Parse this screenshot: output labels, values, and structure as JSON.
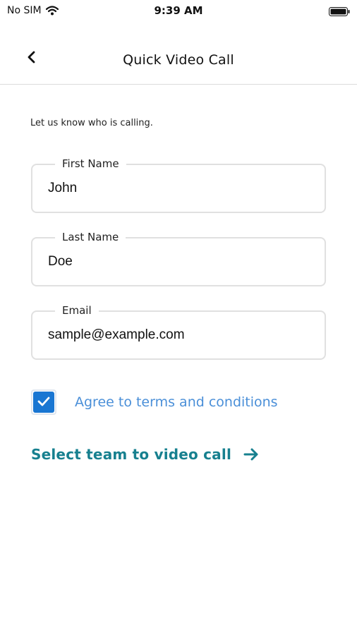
{
  "status_bar": {
    "carrier": "No SIM",
    "time": "9:39 AM",
    "icons": [
      "wifi-icon",
      "battery-icon"
    ]
  },
  "nav": {
    "title": "Quick Video Call",
    "back_icon": "chevron-left-icon"
  },
  "form": {
    "intro": "Let us know who is calling.",
    "first_name": {
      "label": "First Name",
      "value": "John"
    },
    "last_name": {
      "label": "Last Name",
      "value": "Doe"
    },
    "email": {
      "label": "Email",
      "value": "sample@example.com"
    },
    "agree": {
      "label": "Agree to terms and conditions",
      "checked": true
    }
  },
  "action": {
    "label": "Select team to video call",
    "icon": "arrow-right-icon"
  },
  "colors": {
    "accent_blue": "#1976d2",
    "link_blue": "#4a8fd8",
    "teal": "#17808f",
    "field_border": "#e0e0e0"
  }
}
